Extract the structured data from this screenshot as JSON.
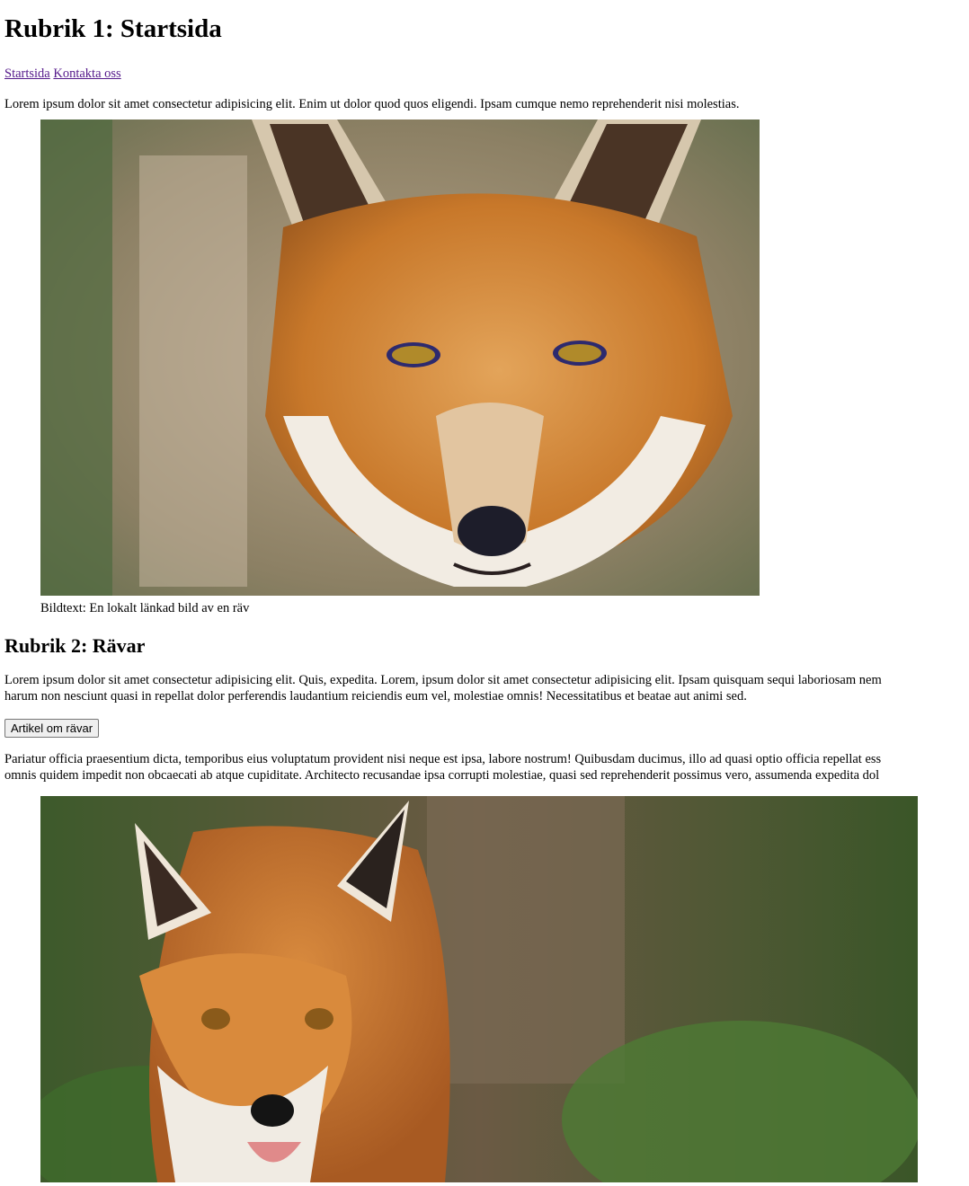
{
  "header": {
    "title": "Rubrik 1: Startsida"
  },
  "nav": {
    "items": [
      "Startsida",
      "Kontakta oss"
    ]
  },
  "intro_text": "Lorem ipsum dolor sit amet consectetur adipisicing elit. Enim ut dolor quod quos eligendi. Ipsam cumque nemo reprehenderit nisi molestias.",
  "figure1": {
    "caption": "Bildtext: En lokalt länkad bild av en räv",
    "icon": "fox-photo"
  },
  "section": {
    "title": "Rubrik 2: Rävar",
    "paragraph1_line1": "Lorem ipsum dolor sit amet consectetur adipisicing elit. Quis, expedita. Lorem, ipsum dolor sit amet consectetur adipisicing elit. Ipsam quisquam sequi laboriosam nem",
    "paragraph1_line2": "harum non nesciunt quasi in repellat dolor perferendis laudantium reiciendis eum vel, molestiae omnis! Necessitatibus et beatae aut animi sed.",
    "button_label": "Artikel om rävar",
    "paragraph2_line1": "Pariatur officia praesentium dicta, temporibus eius voluptatum provident nisi neque est ipsa, labore nostrum! Quibusdam ducimus, illo ad quasi optio officia repellat ess",
    "paragraph2_line2": "omnis quidem impedit non obcaecati ab atque cupiditate. Architecto recusandae ipsa corrupti molestiae, quasi sed reprehenderit possimus vero, assumenda expedita dol"
  },
  "figure2": {
    "icon": "fox-photo"
  },
  "colors": {
    "link": "#551a8b",
    "fox_orange": "#c8782a",
    "foliage": "#3f5a2a"
  }
}
